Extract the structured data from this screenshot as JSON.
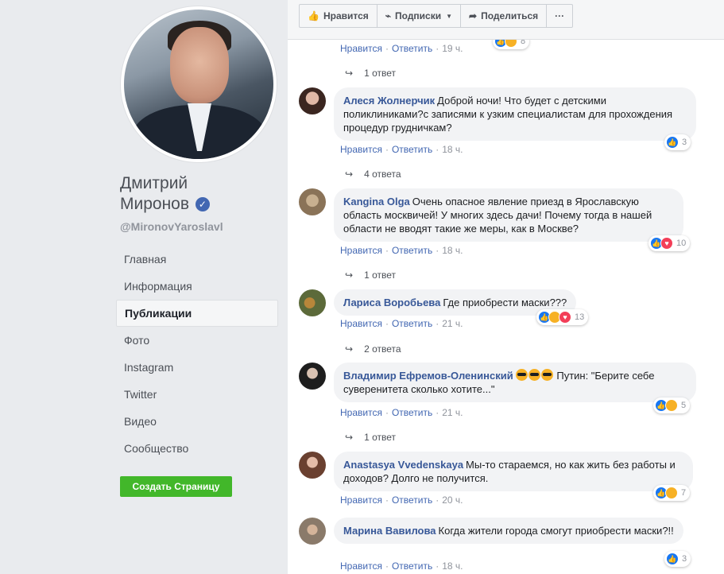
{
  "page": {
    "name_line1": "Дмитрий",
    "name_line2": "Миронов",
    "handle": "@MironovYaroslavl",
    "verified_glyph": "✓"
  },
  "nav": {
    "items": [
      "Главная",
      "Информация",
      "Публикации",
      "Фото",
      "Instagram",
      "Twitter",
      "Видео",
      "Сообщество"
    ],
    "active": "Публикации"
  },
  "create_page_label": "Создать Страницу",
  "actions": {
    "like": "Нравится",
    "follow": "Подписки",
    "share": "Поделиться",
    "more": "···"
  },
  "labels": {
    "like": "Нравится",
    "reply": "Ответить",
    "dot": "·"
  },
  "comments": [
    {
      "author": "",
      "text": "",
      "time": "19 ч.",
      "reactions_count": "8",
      "replies": "1 ответ"
    },
    {
      "author": "Алеся Жолнерчик",
      "text": "Доброй ночи! Что будет с детскими поликлиниками?с записями к узким специалистам для прохождения процедур грудничкам?",
      "time": "18 ч.",
      "reactions_count": "3",
      "replies": "4 ответа"
    },
    {
      "author": "Kangina Olga",
      "text": "Очень опасное явление приезд в Ярославскую область москвичей! У многих здесь дачи! Почему тогда в нашей области не вводят такие же меры, как в Москве?",
      "time": "18 ч.",
      "reactions_count": "10",
      "replies": "1 ответ"
    },
    {
      "author": "Лариса Воробьева",
      "text": "Где приобрести маски???",
      "time": "21 ч.",
      "reactions_count": "13",
      "replies": "2 ответа"
    },
    {
      "author": "Владимир Ефремов-Оленинский",
      "text": "Путин: \"Берите себе суверенитета сколько хотите...\"",
      "time": "21 ч.",
      "reactions_count": "5",
      "replies": "1 ответ"
    },
    {
      "author": "Anastasya Vvedenskaya",
      "text": "Мы-то стараемся, но как жить без работы и доходов? Долго не получится.",
      "time": "20 ч.",
      "reactions_count": "7",
      "replies": ""
    },
    {
      "author": "Марина Вавилова",
      "text": "Когда жители города смогут приобрести маски?!!",
      "time": "18 ч.",
      "reactions_count": "3",
      "replies": ""
    }
  ],
  "colors": {
    "link": "#385898",
    "green": "#42b72a",
    "like_blue": "#1877f2",
    "love_red": "#f33e58",
    "haha_yellow": "#f7b125"
  }
}
